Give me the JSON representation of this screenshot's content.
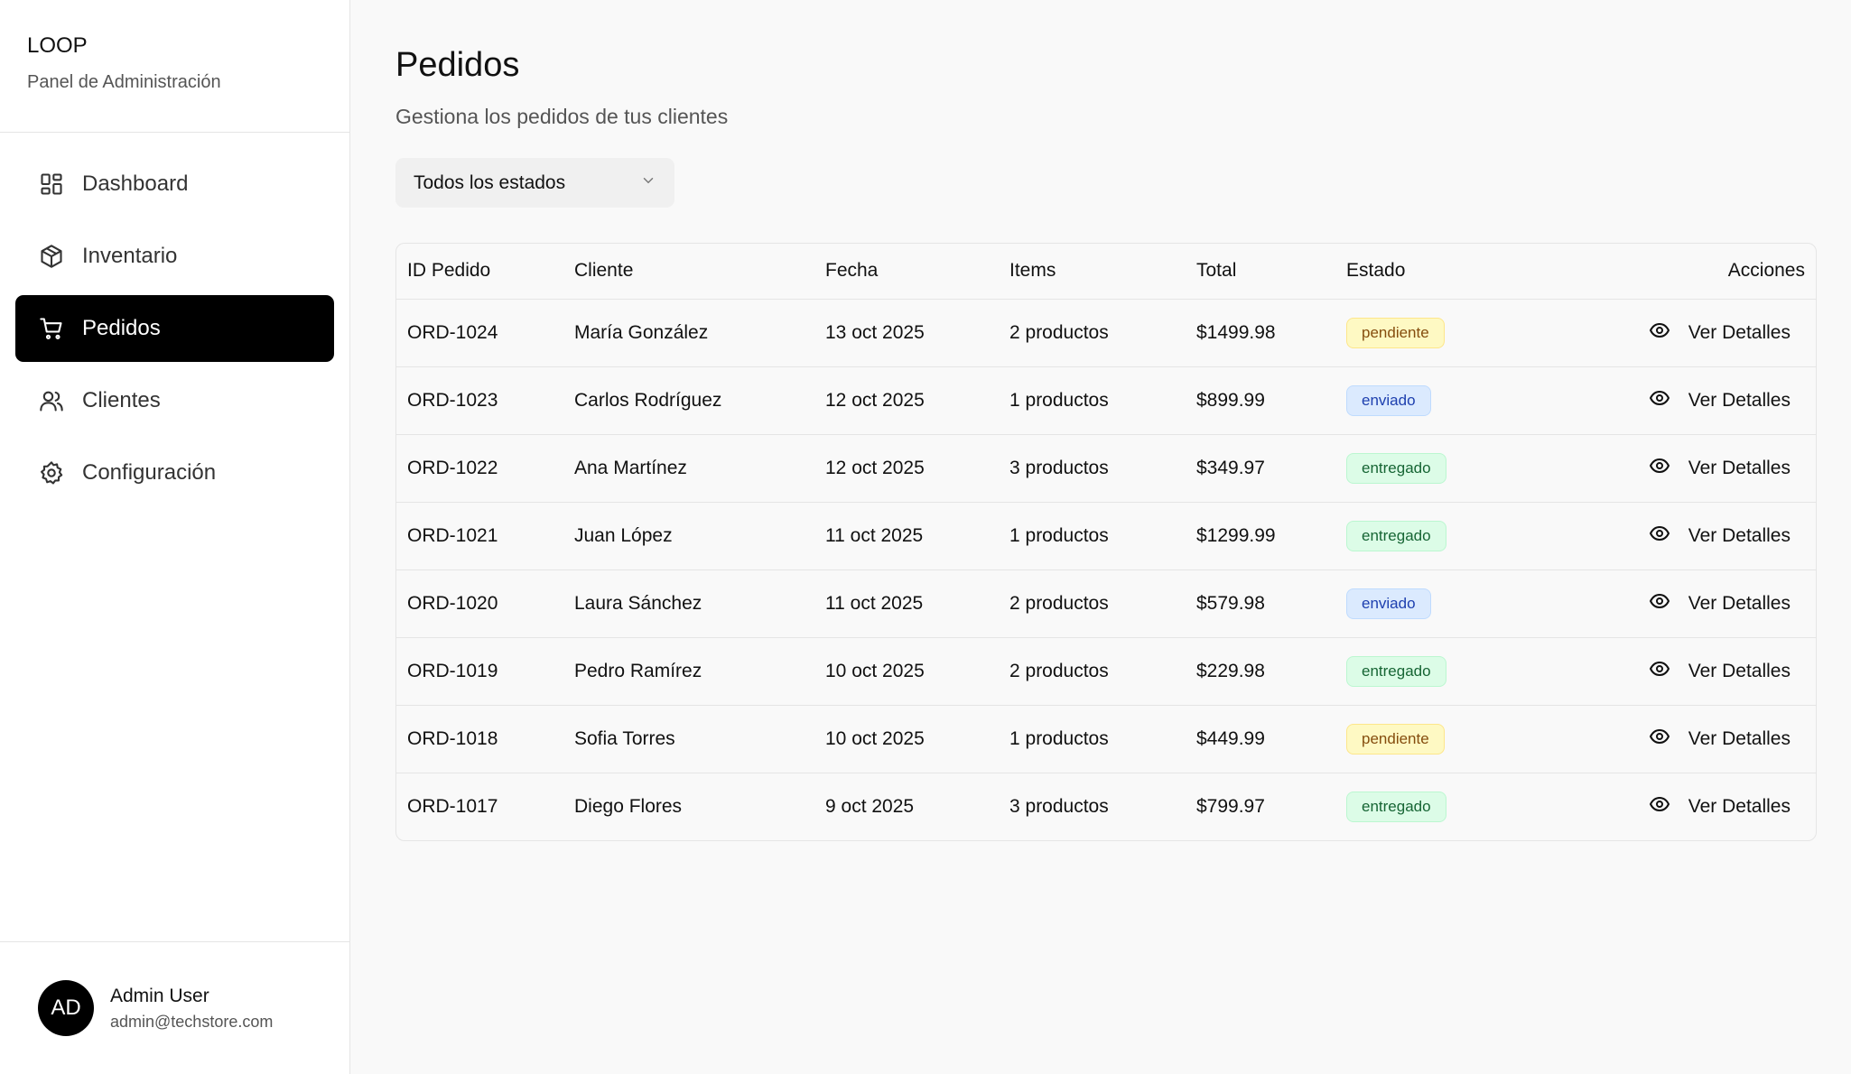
{
  "brand": {
    "name": "LOOP",
    "subtitle": "Panel de Administración"
  },
  "nav": [
    {
      "label": "Dashboard",
      "icon": "dashboard-icon"
    },
    {
      "label": "Inventario",
      "icon": "package-icon"
    },
    {
      "label": "Pedidos",
      "icon": "cart-icon",
      "active": true
    },
    {
      "label": "Clientes",
      "icon": "users-icon"
    },
    {
      "label": "Configuración",
      "icon": "gear-icon"
    }
  ],
  "user": {
    "initials": "AD",
    "name": "Admin User",
    "email": "admin@techstore.com"
  },
  "page": {
    "title": "Pedidos",
    "subtitle": "Gestiona los pedidos de tus clientes"
  },
  "filter": {
    "value": "Todos los estados",
    "icon": "chevron-down-icon"
  },
  "table": {
    "headers": [
      "ID Pedido",
      "Cliente",
      "Fecha",
      "Items",
      "Total",
      "Estado",
      "Acciones"
    ],
    "action_label": "Ver Detalles",
    "action_icon": "eye-icon",
    "rows": [
      {
        "id": "ORD-1024",
        "client": "María González",
        "date": "13 oct 2025",
        "items": "2 productos",
        "total": "$1499.98",
        "status": "pendiente"
      },
      {
        "id": "ORD-1023",
        "client": "Carlos Rodríguez",
        "date": "12 oct 2025",
        "items": "1 productos",
        "total": "$899.99",
        "status": "enviado"
      },
      {
        "id": "ORD-1022",
        "client": "Ana Martínez",
        "date": "12 oct 2025",
        "items": "3 productos",
        "total": "$349.97",
        "status": "entregado"
      },
      {
        "id": "ORD-1021",
        "client": "Juan López",
        "date": "11 oct 2025",
        "items": "1 productos",
        "total": "$1299.99",
        "status": "entregado"
      },
      {
        "id": "ORD-1020",
        "client": "Laura Sánchez",
        "date": "11 oct 2025",
        "items": "2 productos",
        "total": "$579.98",
        "status": "enviado"
      },
      {
        "id": "ORD-1019",
        "client": "Pedro Ramírez",
        "date": "10 oct 2025",
        "items": "2 productos",
        "total": "$229.98",
        "status": "entregado"
      },
      {
        "id": "ORD-1018",
        "client": "Sofia Torres",
        "date": "10 oct 2025",
        "items": "1 productos",
        "total": "$449.99",
        "status": "pendiente"
      },
      {
        "id": "ORD-1017",
        "client": "Diego Flores",
        "date": "9 oct 2025",
        "items": "3 productos",
        "total": "$799.97",
        "status": "entregado"
      }
    ]
  },
  "colors": {
    "active_nav_bg": "#000000",
    "pendiente": "#fef9c3",
    "enviado": "#dbeafe",
    "entregado": "#dcfce7"
  }
}
